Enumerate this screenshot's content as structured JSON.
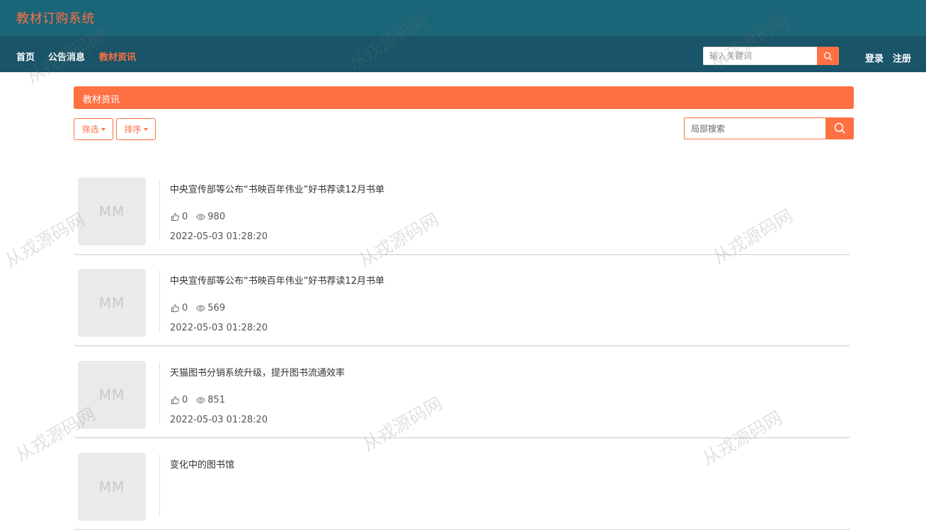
{
  "header": {
    "app_title": "教材订购系统"
  },
  "nav": {
    "items": [
      {
        "label": "首页",
        "active": false
      },
      {
        "label": "公告消息",
        "active": false
      },
      {
        "label": "教材资讯",
        "active": true
      }
    ],
    "search_placeholder": "输入关键词",
    "login_label": "登录",
    "register_label": "注册"
  },
  "section": {
    "title": "教材资讯"
  },
  "toolbar": {
    "filter_label": "筛选",
    "sort_label": "排序",
    "local_search_placeholder": "局部搜索"
  },
  "news": [
    {
      "thumb": "MM",
      "title": "中央宣传部等公布“书映百年伟业”好书荐读12月书单",
      "likes": "0",
      "views": "980",
      "time": "2022-05-03 01:28:20"
    },
    {
      "thumb": "MM",
      "title": "中央宣传部等公布“书映百年伟业”好书荐读12月书单",
      "likes": "0",
      "views": "569",
      "time": "2022-05-03 01:28:20"
    },
    {
      "thumb": "MM",
      "title": "天猫图书分销系统升级，提升图书流通效率",
      "likes": "0",
      "views": "851",
      "time": "2022-05-03 01:28:20"
    },
    {
      "thumb": "MM",
      "title": "变化中的图书馆",
      "likes": "",
      "views": "",
      "time": ""
    }
  ],
  "watermark": "从戎源码网",
  "colors": {
    "accent": "#ff7043",
    "header_bg": "#1a6577",
    "nav_bg": "#195468"
  },
  "icons": {
    "search": "search-icon",
    "like": "thumbs-up-icon",
    "views": "eye-icon"
  }
}
